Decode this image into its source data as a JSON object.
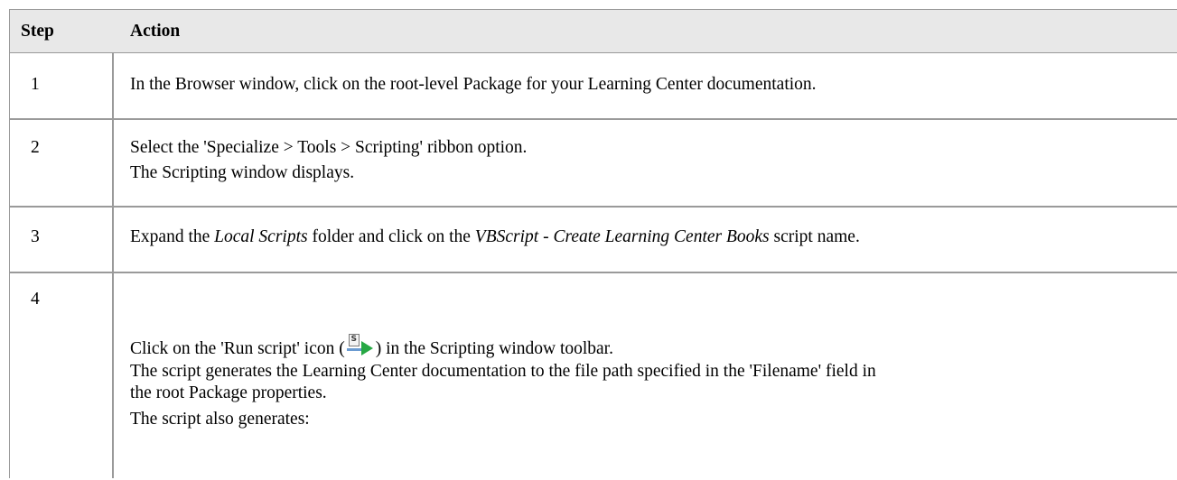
{
  "table": {
    "headers": {
      "step": "Step",
      "action": "Action"
    },
    "rows": [
      {
        "step": "1",
        "lines": [
          "In the Browser window, click on the root-level Package for your Learning Center documentation."
        ]
      },
      {
        "step": "2",
        "lines": [
          "Select the 'Specialize > Tools > Scripting' ribbon option.",
          "The Scripting window displays."
        ]
      },
      {
        "step": "3",
        "parts": {
          "a": "Expand the ",
          "b": "Local Scripts",
          "c": " folder and click on the ",
          "d": "VBScript - Create Learning Center Books",
          "e": " script name."
        }
      },
      {
        "step": "4",
        "run_line": {
          "before": "Click on the 'Run script' icon (",
          "after": ") in the Scripting window toolbar."
        },
        "lines": [
          "The script generates the Learning Center documentation to the file path specified in the 'Filename' field in",
          "the root Package properties.",
          "The script also generates:"
        ],
        "icon": "run-script-icon"
      }
    ]
  },
  "colors": {
    "header_bg": "#e8e8e8",
    "border": "#9a9a9a"
  }
}
